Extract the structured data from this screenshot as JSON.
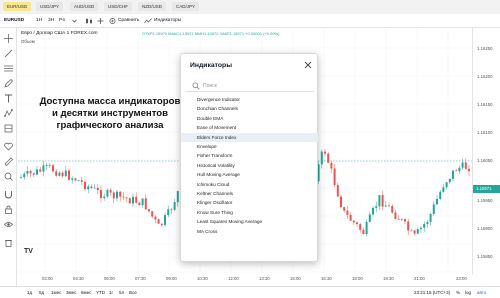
{
  "symbol_tabs": [
    "EUR/USD",
    "USD/JPY",
    "AUD/USD",
    "USD/CHF",
    "NZD/USD",
    "CAD/JPY"
  ],
  "toolbar": {
    "symbol": "EURUSD",
    "intervals": [
      "1H",
      "3H",
      "P4"
    ],
    "compare_label": "Сравнить",
    "indicators_label": "Индикаторы"
  },
  "legend": {
    "title": "Евро / Доллар США   1   FOREX.com",
    "ohlc": "ОТКР1.15970 МАКС1.15971 МИН1.15970 ЗАКР1.15971 +0.00001 (+0.00%)",
    "volume": "Объем"
  },
  "promo_lines": [
    "Доступна масса индикаторов",
    "и десятки инструментов",
    "графического анализа"
  ],
  "dialog": {
    "title": "Индикаторы",
    "search_placeholder": "Поиск",
    "items": [
      "Divergence Indicator",
      "Donchian Channels",
      "Double EMA",
      "Ease of Movement",
      "Elders Force Index",
      "Envelope",
      "Fisher Transform",
      "Historical Volatility",
      "Hull Moving Average",
      "Ichimoku Cloud",
      "Keltner Channels",
      "Klinger Oscillator",
      "Know Sure Thing",
      "Least Squares Moving Average",
      "MA Cross"
    ],
    "highlighted_index": 4
  },
  "price_axis": [
    "1.16250",
    "1.16200",
    "1.16150",
    "1.16100",
    "1.16050",
    "1.15971",
    "1.15950",
    "1.15900",
    "1.15850"
  ],
  "current_price": "1.15971",
  "time_axis": [
    "03:00",
    "04:30",
    "06:00",
    "07:30",
    "09:00",
    "10:30",
    "12:00",
    "13:30",
    "15:00",
    "16:30",
    "18:00",
    "19:30",
    "21:00",
    "23:00"
  ],
  "bottom": {
    "ranges": [
      "1д",
      "5д",
      "1мес",
      "3мес",
      "6мес",
      "YTD",
      "1г",
      "5л",
      "Все"
    ],
    "clock": "23:21:15 (UTC+3)",
    "toggles": [
      "%",
      "log",
      "авто"
    ]
  },
  "colors": {
    "up": "#26a69a",
    "down": "#ef5350",
    "active_tab": "#f7e78e",
    "highlight_row": "#e9eef8"
  }
}
